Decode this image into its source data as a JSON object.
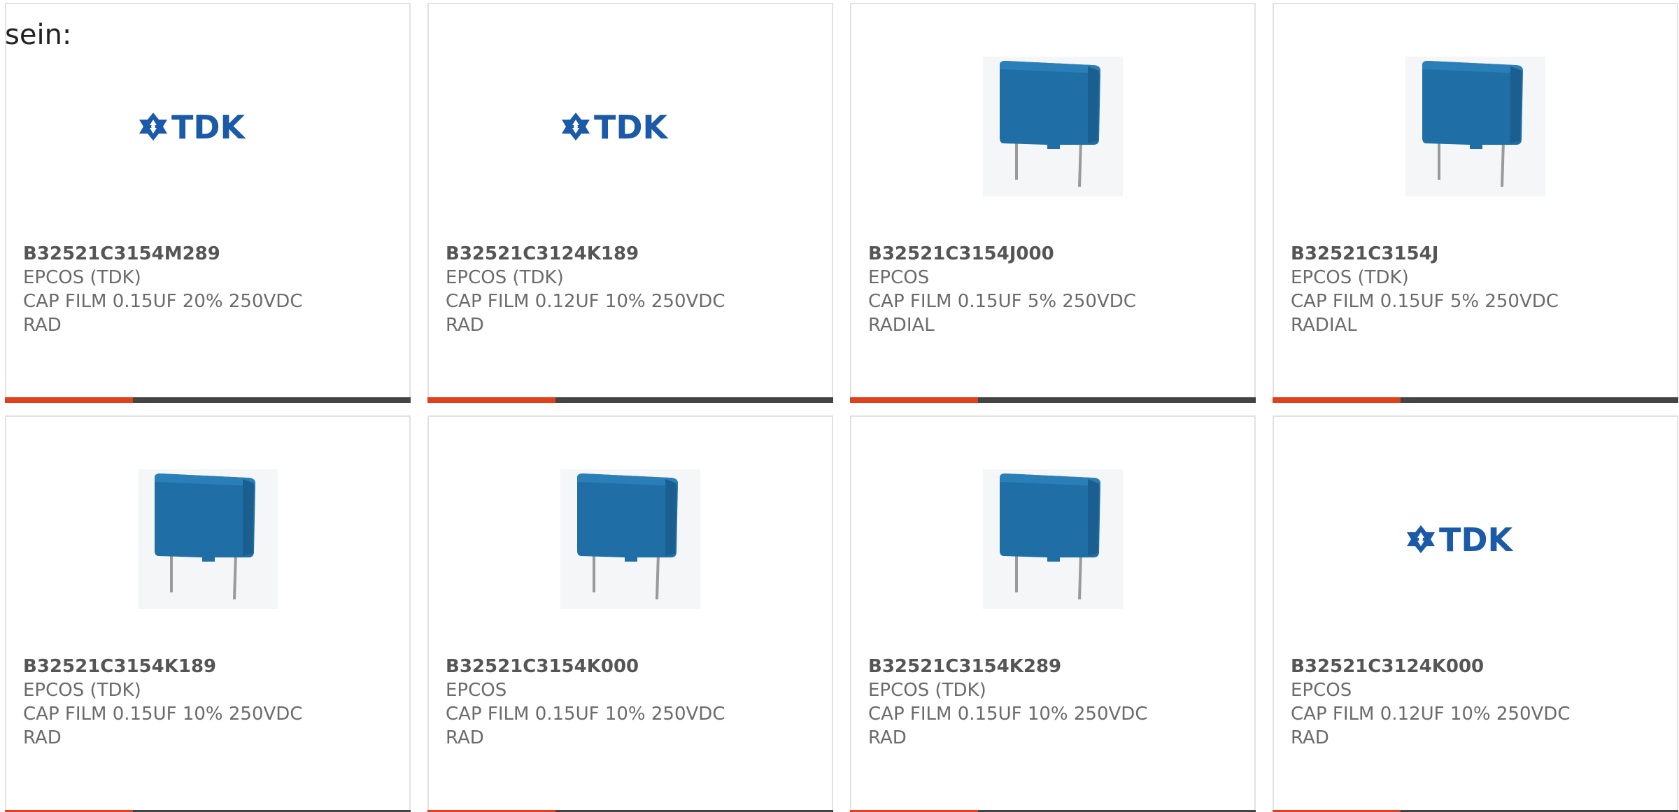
{
  "intro_text": "sein:",
  "colors": {
    "accent": "#e0401b",
    "bar": "#444444",
    "capacitor_blue": "#1f6ea6",
    "tdk_blue": "#1a5aa8"
  },
  "products": [
    {
      "part_number": "B32521C3154M289",
      "manufacturer": "EPCOS (TDK)",
      "desc_line1": "CAP FILM 0.15UF 20% 250VDC",
      "desc_line2": "RAD",
      "image": "tdk-logo"
    },
    {
      "part_number": "B32521C3124K189",
      "manufacturer": "EPCOS (TDK)",
      "desc_line1": "CAP FILM 0.12UF 10% 250VDC",
      "desc_line2": "RAD",
      "image": "tdk-logo"
    },
    {
      "part_number": "B32521C3154J000",
      "manufacturer": "EPCOS",
      "desc_line1": "CAP FILM 0.15UF 5% 250VDC",
      "desc_line2": "RADIAL",
      "image": "capacitor-photo"
    },
    {
      "part_number": "B32521C3154J",
      "manufacturer": "EPCOS (TDK)",
      "desc_line1": "CAP FILM 0.15UF 5% 250VDC",
      "desc_line2": "RADIAL",
      "image": "capacitor-photo"
    },
    {
      "part_number": "B32521C3154K189",
      "manufacturer": "EPCOS (TDK)",
      "desc_line1": "CAP FILM 0.15UF 10% 250VDC",
      "desc_line2": "RAD",
      "image": "capacitor-photo"
    },
    {
      "part_number": "B32521C3154K000",
      "manufacturer": "EPCOS",
      "desc_line1": "CAP FILM 0.15UF 10% 250VDC",
      "desc_line2": "RAD",
      "image": "capacitor-photo"
    },
    {
      "part_number": "B32521C3154K289",
      "manufacturer": "EPCOS (TDK)",
      "desc_line1": "CAP FILM 0.15UF 10% 250VDC",
      "desc_line2": "RAD",
      "image": "capacitor-photo"
    },
    {
      "part_number": "B32521C3124K000",
      "manufacturer": "EPCOS",
      "desc_line1": "CAP FILM 0.12UF 10% 250VDC",
      "desc_line2": "RAD",
      "image": "tdk-logo"
    }
  ]
}
